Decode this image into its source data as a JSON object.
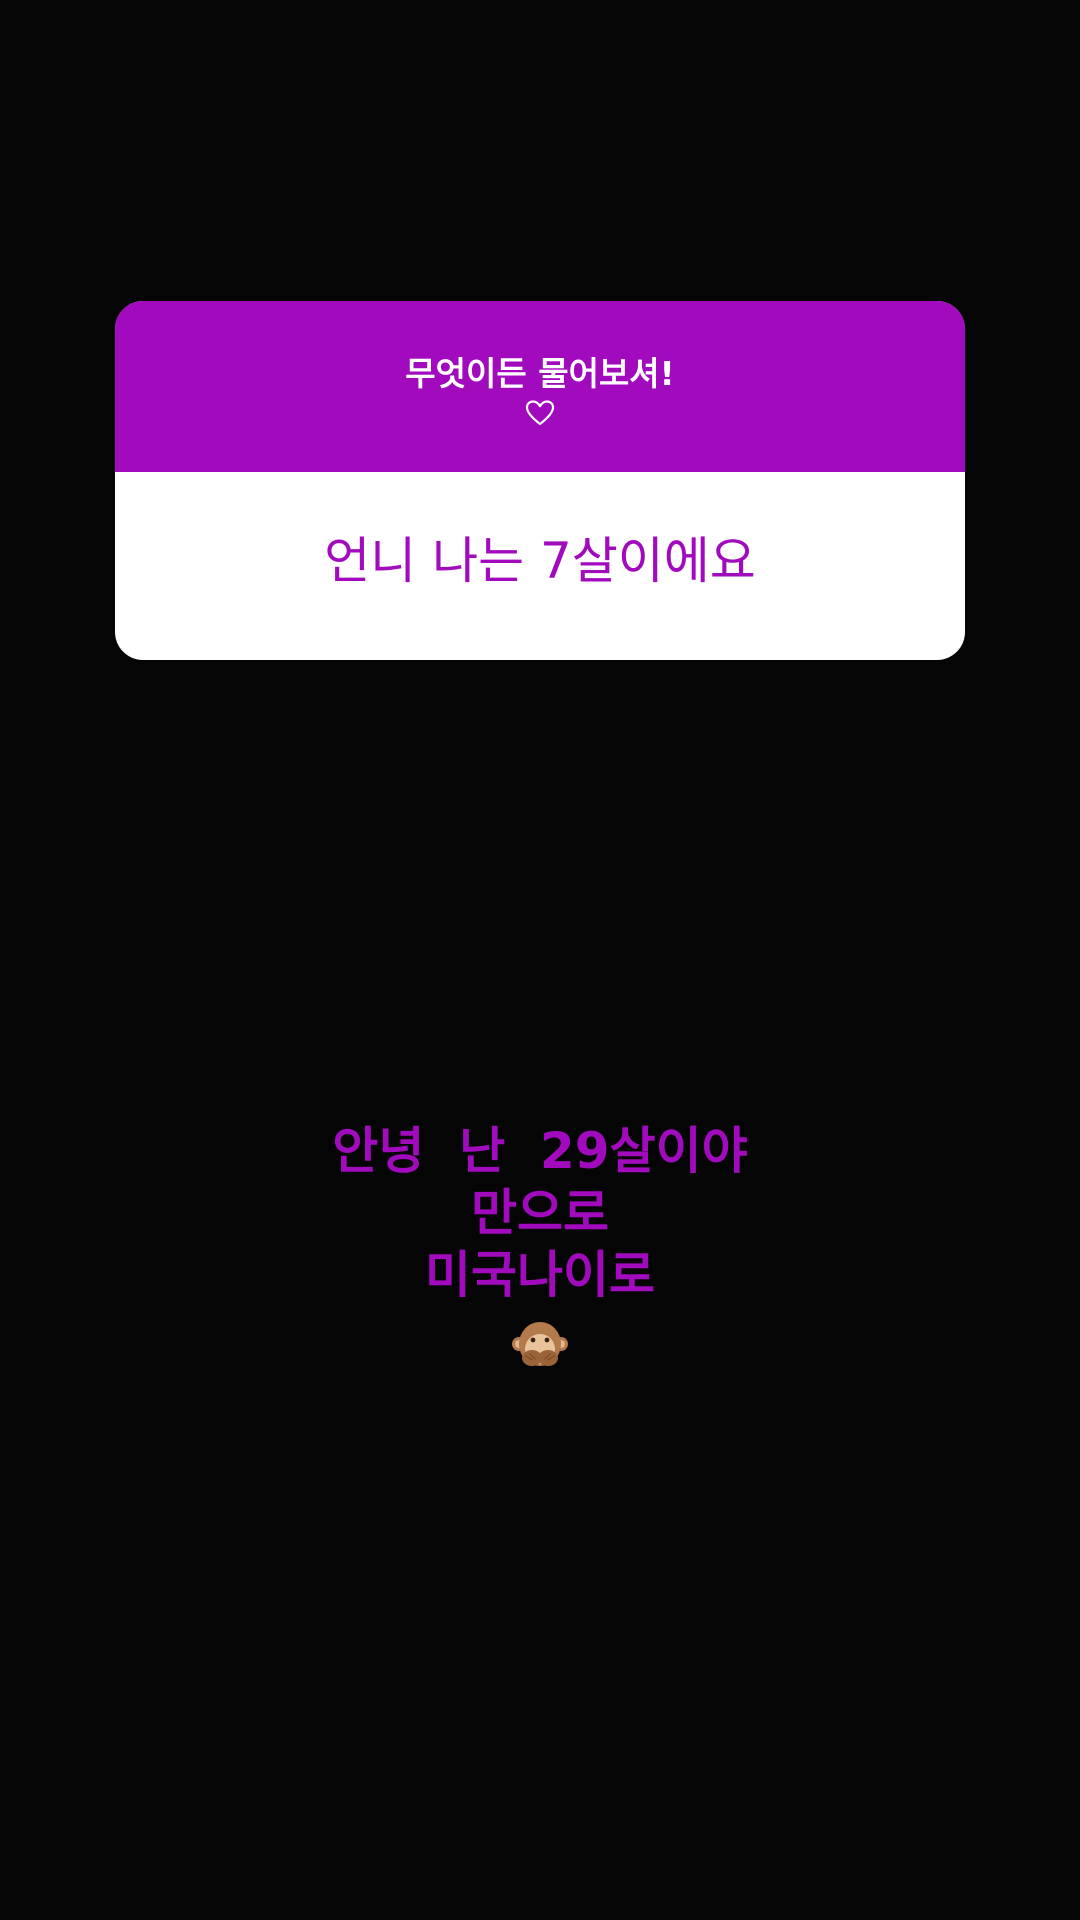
{
  "question_sticker": {
    "title": "무엇이든 물어보셔!",
    "icon": "heart-outline-icon",
    "answer": "언니 나는 7살이에요",
    "accent_color": "#a10bbd"
  },
  "caption": {
    "lines": [
      "안녕  난  29살이야",
      "만으로",
      "미국나이로"
    ],
    "emoji": "see-no-evil-monkey-icon",
    "color": "#a10bbd"
  }
}
